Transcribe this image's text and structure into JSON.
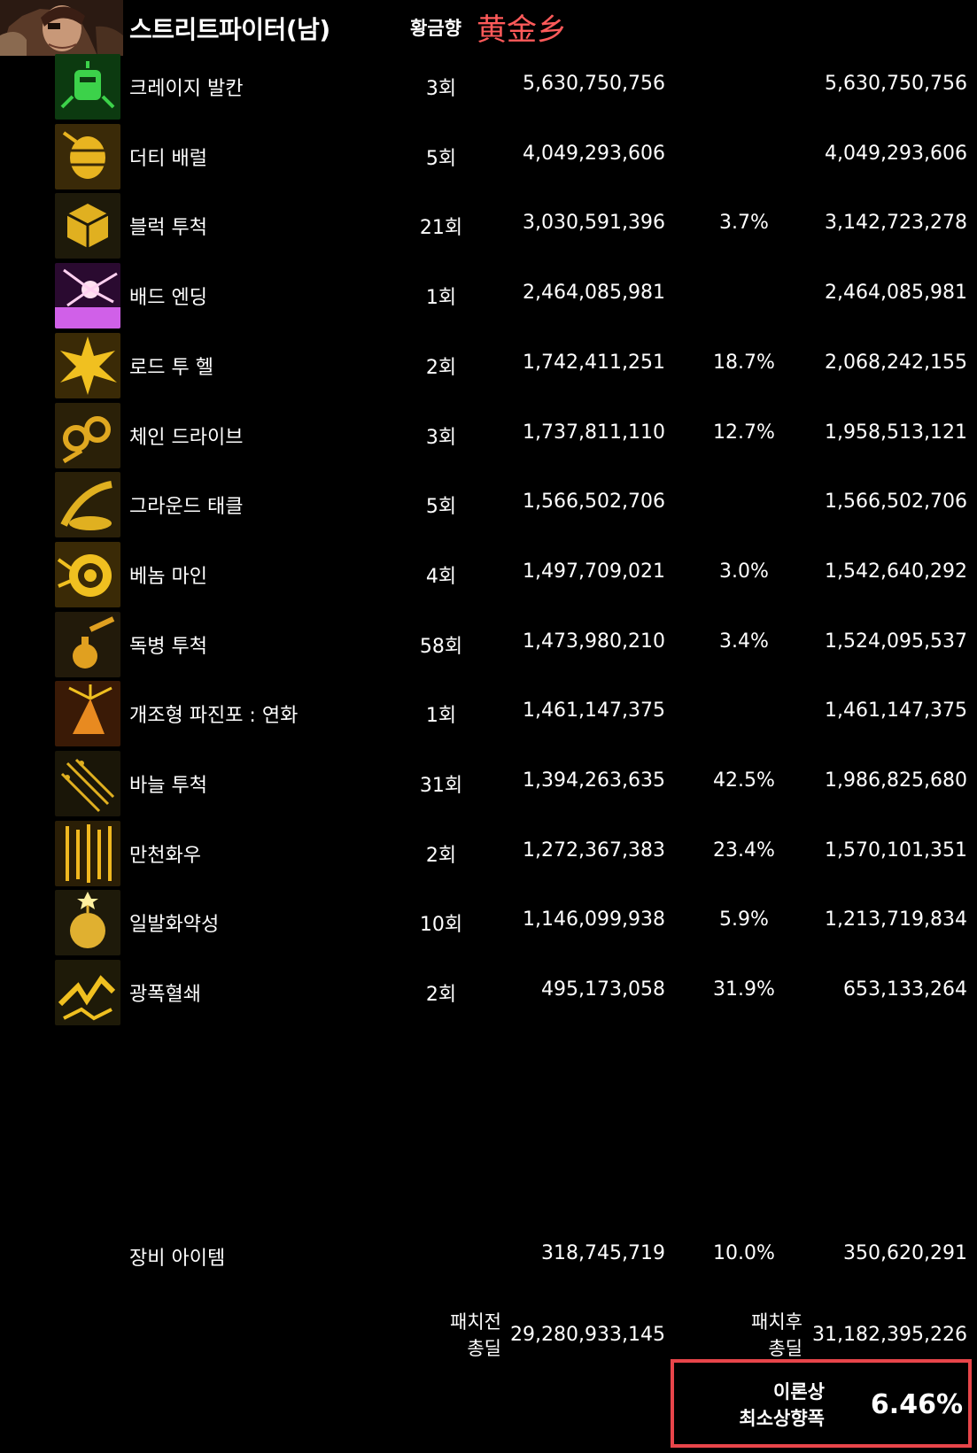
{
  "header": {
    "character": "스트리트파이터(남)",
    "server_label": "황금향",
    "nickname": "黄金乡"
  },
  "skills": [
    {
      "name": "크레이지 발칸",
      "hits": "3회",
      "before": "5,630,750,756",
      "rate": "",
      "after": "5,630,750,756",
      "icon": "green-fist-icon"
    },
    {
      "name": "더티 배럴",
      "hits": "5회",
      "before": "4,049,293,606",
      "rate": "",
      "after": "4,049,293,606",
      "icon": "barrel-icon"
    },
    {
      "name": "블럭 투척",
      "hits": "21회",
      "before": "3,030,591,396",
      "rate": "3.7%",
      "after": "3,142,723,278",
      "icon": "block-icon"
    },
    {
      "name": "배드 엔딩",
      "hits": "1회",
      "before": "2,464,085,981",
      "rate": "",
      "after": "2,464,085,981",
      "icon": "purple-burst-icon"
    },
    {
      "name": "로드 투 헬",
      "hits": "2회",
      "before": "1,742,411,251",
      "rate": "18.7%",
      "after": "2,068,242,155",
      "icon": "explosion-icon"
    },
    {
      "name": "체인 드라이브",
      "hits": "3회",
      "before": "1,737,811,110",
      "rate": "12.7%",
      "after": "1,958,513,121",
      "icon": "chain-icon"
    },
    {
      "name": "그라운드 태클",
      "hits": "5회",
      "before": "1,566,502,706",
      "rate": "",
      "after": "1,566,502,706",
      "icon": "tackle-icon"
    },
    {
      "name": "베놈 마인",
      "hits": "4회",
      "before": "1,497,709,021",
      "rate": "3.0%",
      "after": "1,542,640,292",
      "icon": "venom-mine-icon"
    },
    {
      "name": "독병 투척",
      "hits": "58회",
      "before": "1,473,980,210",
      "rate": "3.4%",
      "after": "1,524,095,537",
      "icon": "poison-bottle-icon"
    },
    {
      "name": "개조형 파진포 : 연화",
      "hits": "1회",
      "before": "1,461,147,375",
      "rate": "",
      "after": "1,461,147,375",
      "icon": "firework-icon"
    },
    {
      "name": "바늘 투척",
      "hits": "31회",
      "before": "1,394,263,635",
      "rate": "42.5%",
      "after": "1,986,825,680",
      "icon": "needle-icon"
    },
    {
      "name": "만천화우",
      "hits": "2회",
      "before": "1,272,367,383",
      "rate": "23.4%",
      "after": "1,570,101,351",
      "icon": "rain-icon"
    },
    {
      "name": "일발화약성",
      "hits": "10회",
      "before": "1,146,099,938",
      "rate": "5.9%",
      "after": "1,213,719,834",
      "icon": "bomb-icon"
    },
    {
      "name": "광폭혈쇄",
      "hits": "2회",
      "before": "495,173,058",
      "rate": "31.9%",
      "after": "653,133,264",
      "icon": "lightning-icon"
    }
  ],
  "equipment": {
    "name": "장비 아이템",
    "before": "318,745,719",
    "rate": "10.0%",
    "after": "350,620,291"
  },
  "totals": {
    "before_label_1": "패치전",
    "before_label_2": "총딜",
    "before_value": "29,280,933,145",
    "after_label_1": "패치후",
    "after_label_2": "총딜",
    "after_value": "31,182,395,226"
  },
  "result": {
    "label_1": "이론상",
    "label_2": "최소상향폭",
    "value": "6.46%"
  },
  "colors": {
    "background": "#000000",
    "nickname": "#ff5a5a",
    "highlight_border": "#e8454a",
    "icon_gold": "#e8b420"
  }
}
